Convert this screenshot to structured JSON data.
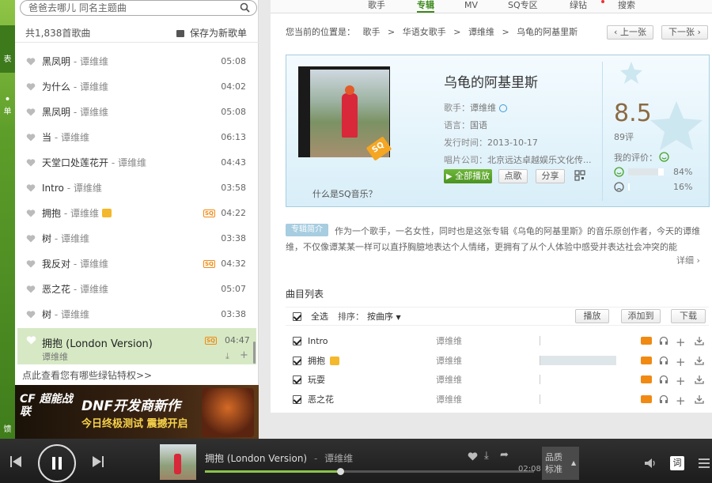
{
  "left_strip": {
    "label_1": "表",
    "label_2": "单",
    "label_3": "馈"
  },
  "playlist": {
    "search_placeholder": "爸爸去哪儿 同名主题曲",
    "count_text": "共1,838首歌曲",
    "save_label": "保存为新歌单",
    "rows": [
      {
        "title": "黑凤明",
        "artist": "谭维维",
        "time": "05:08"
      },
      {
        "title": "为什么",
        "artist": "谭维维",
        "time": "04:02"
      },
      {
        "title": "黑凤明",
        "artist": "谭维维",
        "time": "05:08"
      },
      {
        "title": "当",
        "artist": "谭维维",
        "time": "06:13"
      },
      {
        "title": "天堂口处莲花开",
        "artist": "谭维维",
        "time": "04:43"
      },
      {
        "title": "Intro",
        "artist": "谭维维",
        "time": "03:58"
      },
      {
        "title": "拥抱",
        "artist": "谭维维",
        "time": "04:22",
        "sq": "SQ"
      },
      {
        "title": "树",
        "artist": "谭维维",
        "time": "03:38"
      },
      {
        "title": "我反对",
        "artist": "谭维维",
        "time": "04:32",
        "sq": "SQ"
      },
      {
        "title": "恶之花",
        "artist": "谭维维",
        "time": "05:07"
      },
      {
        "title": "树",
        "artist": "谭维维",
        "time": "03:38"
      }
    ],
    "active": {
      "title": "拥抱 (London Version)",
      "artist": "谭维维",
      "time": "04:47",
      "sq": "SQ"
    },
    "vip_link": "点此查看您有哪些绿钻特权>>",
    "banner": {
      "logo": "CF 超能战联",
      "headline": "DNF开发商新作",
      "sub": "今日终极测试 震撼开启"
    }
  },
  "tabs": [
    "歌手",
    "专辑",
    "MV",
    "SQ专区",
    "绿钻",
    "搜索"
  ],
  "breadcrumb": {
    "prefix": "您当前的位置是：",
    "items": [
      "歌手",
      "华语女歌手",
      "谭维维",
      "乌龟的阿基里斯"
    ],
    "sep": ">"
  },
  "pager": {
    "prev": "上一张",
    "next": "下一张"
  },
  "album": {
    "title": "乌龟的阿基里斯",
    "singer_label": "歌手：",
    "singer": "谭维维",
    "lang_label": "语言：",
    "lang": "国语",
    "date_label": "发行时间：",
    "date": "2013-10-17",
    "company_label": "唱片公司：",
    "company": "北京远达卓越娱乐文化传...",
    "play_all": "全部播放",
    "comment": "点歌",
    "share": "分享",
    "sq_badge": "SQ",
    "sq_question": "什么是SQ音乐？",
    "score": "8.5",
    "score_count": "89评",
    "my_rating_label": "我的评价：",
    "like_pct": "84%",
    "dislike_pct": "16%",
    "like_value": 0.84,
    "dislike_value": 0.16
  },
  "intro": {
    "tag": "专辑简介",
    "text": "作为一个歌手，一名女性，同时也是这张专辑《乌龟的阿基里斯》的音乐原创作者，今天的谭维维，不仅像谭某某一样可以直抒胸臆地表达个人情绪，更拥有了从个人体验中感受并表达社会冲突的能",
    "more": "详细"
  },
  "tracklist": {
    "heading": "曲目列表",
    "select_all": "全选",
    "sort_label": "排序：",
    "sort_value": "按曲序",
    "play": "播放",
    "add_to": "添加到",
    "download": "下载",
    "tracks": [
      {
        "name": "Intro",
        "artist": "谭维维",
        "pop": 0.0
      },
      {
        "name": "拥抱",
        "artist": "谭维维",
        "pop": 1.0
      },
      {
        "name": "玩耍",
        "artist": "谭维维",
        "pop": 0.0
      },
      {
        "name": "恶之花",
        "artist": "谭维维",
        "pop": 0.0
      }
    ]
  },
  "player": {
    "track": "拥抱 (London Version)",
    "sep": "-",
    "artist": "谭维维",
    "time": "02:08",
    "quality_1": "品质",
    "quality_2": "标准",
    "progress": 0.41,
    "lyrics": "词"
  },
  "colors": {
    "accent_green": "#3c8a1c",
    "sq_orange": "#f08a12",
    "card_border": "#a6cde0"
  }
}
